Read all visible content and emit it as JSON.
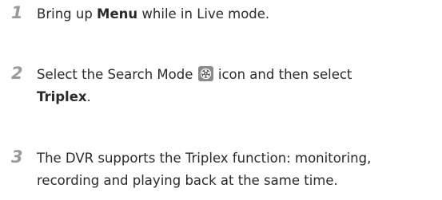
{
  "steps": [
    {
      "number": "1",
      "text_before": "Bring up ",
      "bold": "Menu",
      "text_after": " while in Live mode."
    },
    {
      "number": "2",
      "text_before": "Select the Search Mode ",
      "icon": "search-mode-film-reel-icon",
      "text_middle": " icon and then select",
      "bold": "Triplex",
      "text_after": "."
    },
    {
      "number": "3",
      "line1": "The DVR supports the Triplex function: monitoring,",
      "line2": "recording and playing back at the same time."
    }
  ],
  "colors": {
    "step_number": "#9a9a9a",
    "body_text": "#2a2a2a",
    "icon_bg": "#8a8a8a"
  }
}
